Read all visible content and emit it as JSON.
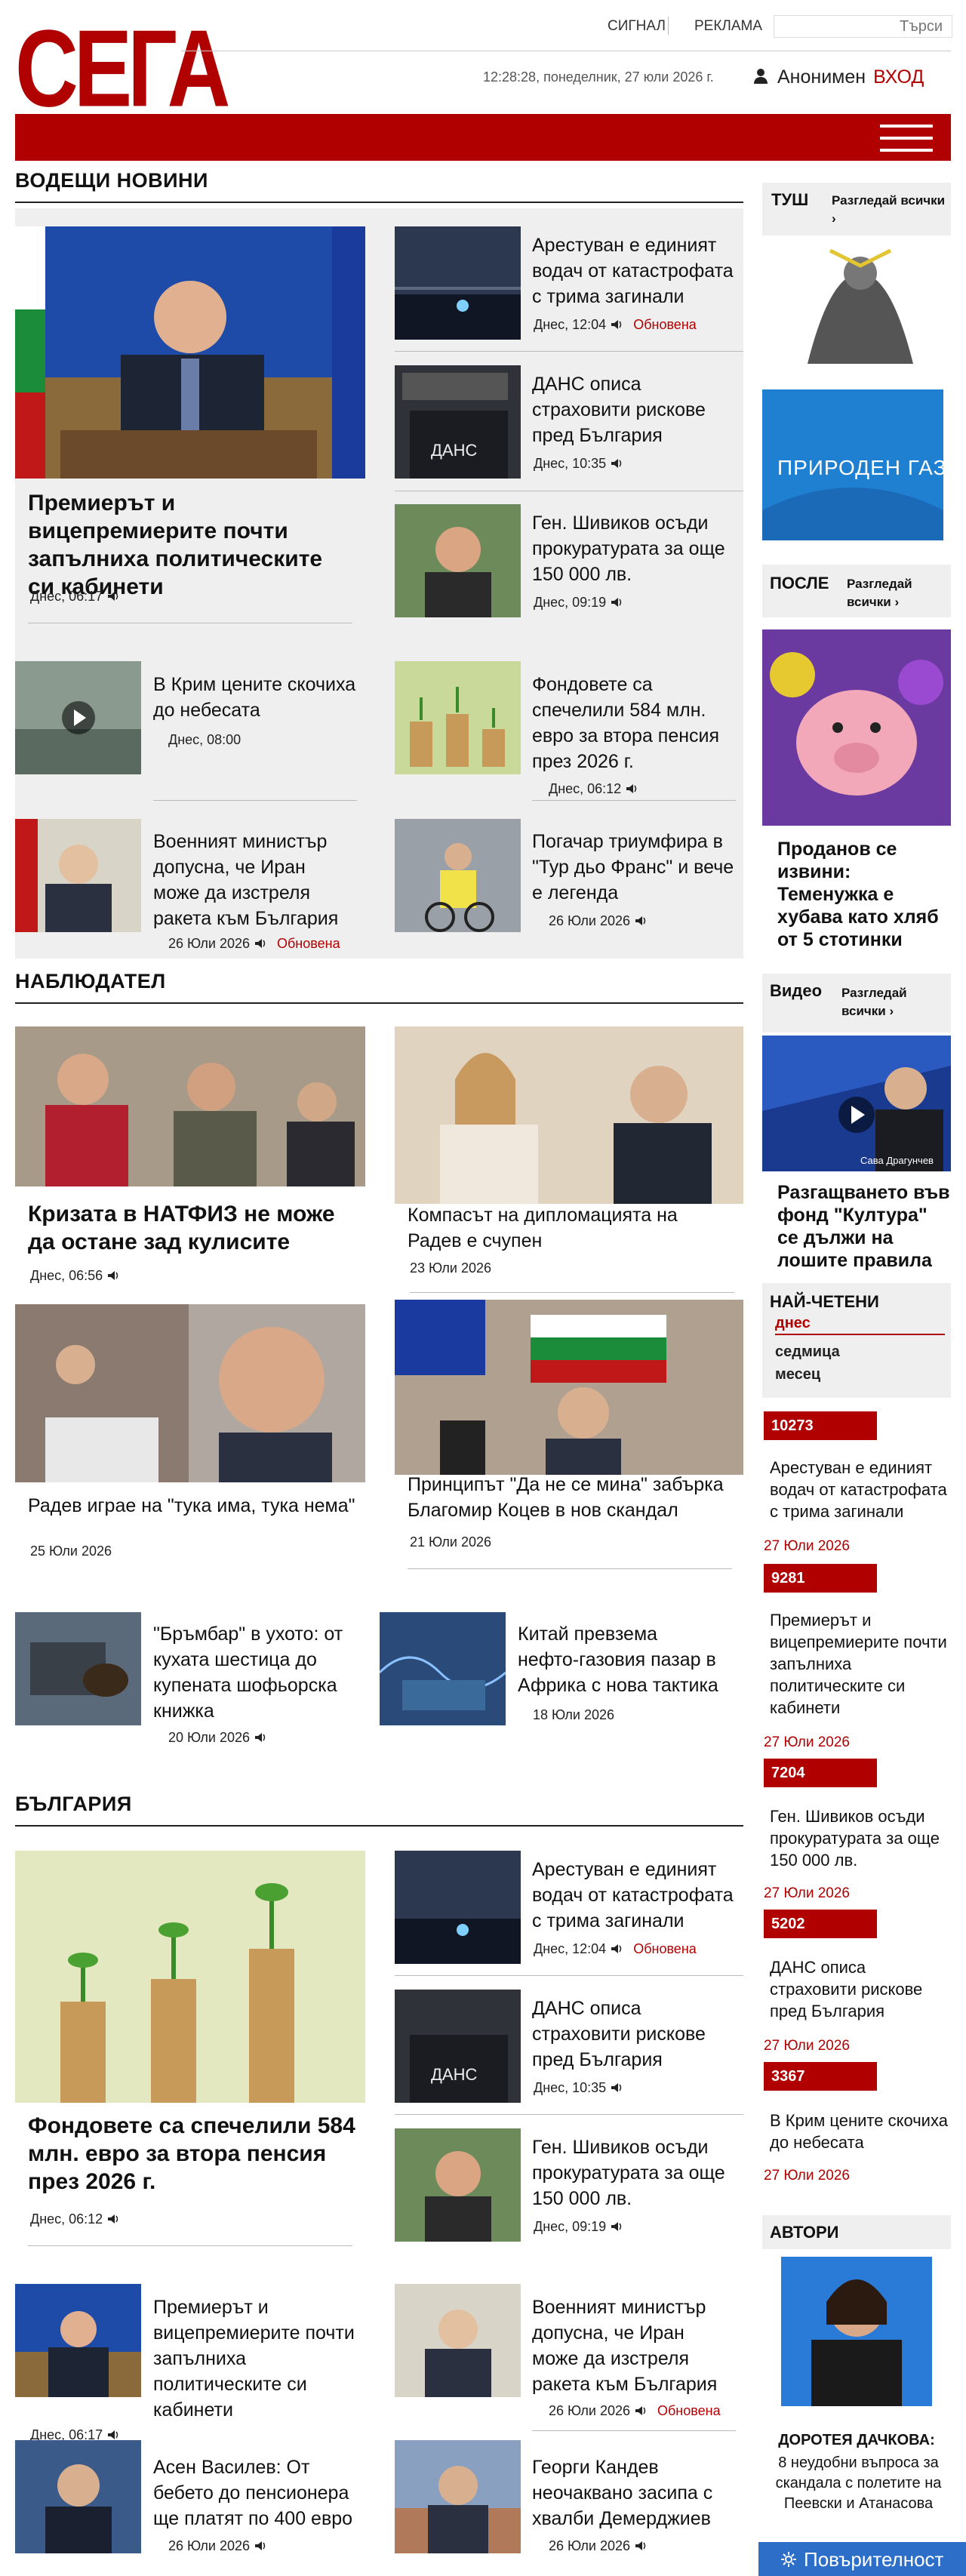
{
  "header": {
    "logo": "СЕГА",
    "links": [
      "СИГНАЛ",
      "РЕКЛАМА"
    ],
    "search_placeholder": "Търси",
    "datetime": "12:28:28, понеделник, 27 юли 2026 г.",
    "user": "Анонимен",
    "login": "ВХОД"
  },
  "sections": {
    "lead": "ВОДЕЩИ НОВИНИ",
    "observer": "НАБЛЮДАТЕЛ",
    "bulgaria": "БЪЛГАРИЯ"
  },
  "lead": {
    "main": {
      "title": "Премиерът и вицепремиерите почти запълниха политическите си кабинети",
      "meta": "Днес, 06:17"
    },
    "side": [
      {
        "title": "Арестуван е единият водач от катастрофата с трима загинали",
        "meta": "Днес, 12:04",
        "badge": "Обновена"
      },
      {
        "title": "ДАНС описа страховити рискове пред България",
        "meta": "Днес, 10:35"
      },
      {
        "title": "Ген. Шивиков осъди прокуратурата за още 150 000 лв.",
        "meta": "Днес, 09:19"
      }
    ],
    "small": [
      {
        "title": "В Крим цените скочиха до небесата",
        "meta": "Днес, 08:00"
      },
      {
        "title": "Фондовете са спечелили 584 млн. евро за втора пенсия през 2026 г.",
        "meta": "Днес, 06:12"
      },
      {
        "title": "Военният министър допусна, че Иран може да изстреля ракета към България",
        "meta": "26 Юли 2026",
        "badge": "Обновена"
      },
      {
        "title": "Погачар триумфира в \"Тур дьо Франс\" и вече е легенда",
        "meta": "26 Юли 2026"
      }
    ]
  },
  "observer": {
    "cards": [
      {
        "title": "Кризата в НАТФИЗ не може да остане зад кулисите",
        "meta": "Днес, 06:56"
      },
      {
        "title": "Компасът на дипломацията на Радев е счупен",
        "meta": "23 Юли 2026"
      },
      {
        "title": "Радев играе на \"тука има, тука нема\"",
        "meta": "25 Юли 2026"
      },
      {
        "title": "Принципът \"Да не се мина\" забърка Благомир Коцев в нов скандал",
        "meta": "21 Юли 2026"
      }
    ],
    "small": [
      {
        "title": "\"Бръмбар\" в ухото: от кухата шестица до купената шофьорска книжка",
        "meta": "20 Юли 2026"
      },
      {
        "title": "Китай превзема нефто-газовия пазар в Африка с нова тактика",
        "meta": "18 Юли 2026"
      }
    ]
  },
  "bulgaria": {
    "main": {
      "title": "Фондовете са спечелили 584 млн. евро за втора пенсия през 2026 г.",
      "meta": "Днес, 06:12"
    },
    "side": [
      {
        "title": "Арестуван е единият водач от катастрофата с трима загинали",
        "meta": "Днес, 12:04",
        "badge": "Обновена"
      },
      {
        "title": "ДАНС описа страховити рискове пред България",
        "meta": "Днес, 10:35"
      },
      {
        "title": "Ген. Шивиков осъди прокуратурата за още 150 000 лв.",
        "meta": "Днес, 09:19"
      }
    ],
    "small": [
      {
        "title": "Премиерът и вицепремиерите почти запълниха политическите си кабинети",
        "meta": "Днес, 06:17"
      },
      {
        "title": "Военният министър допусна, че Иран може да изстреля ракета към България",
        "meta": "26 Юли 2026",
        "badge": "Обновена"
      },
      {
        "title": "Асен Василев: От бебето до пенсионера ще платят по 400 евро",
        "meta": "26 Юли 2026"
      },
      {
        "title": "Георги Кандев неочаквано засипа с хвалби Демерджиев",
        "meta": "26 Юли 2026"
      }
    ]
  },
  "sidebar": {
    "tush": {
      "label": "ТУШ",
      "more": "Разгледай всички"
    },
    "ad": "ПРИРОДЕН ГАЗ",
    "posle": {
      "label": "ПОСЛЕ",
      "more": "Разгледай всички",
      "title": "Проданов се извини: Теменужка е хубава като хляб от 5 стотинки"
    },
    "video": {
      "label": "Видео",
      "more": "Разгледай всички",
      "caption": "Сава Драгунчев",
      "title": "Разгащването във фонд \"Култура\" се дължи на лошите правила"
    },
    "most_read": {
      "label": "НАЙ-ЧЕТЕНИ",
      "tabs": [
        "днес",
        "седмица",
        "месец"
      ],
      "items": [
        {
          "count": "10273",
          "title": "Арестуван е единият водач от катастрофата с трима загинали",
          "date": "27 Юли 2026"
        },
        {
          "count": "9281",
          "title": "Премиерът и вицепремиерите почти запълниха политическите си кабинети",
          "date": "27 Юли 2026"
        },
        {
          "count": "7204",
          "title": "Ген. Шивиков осъди прокуратурата за още 150 000 лв.",
          "date": "27 Юли 2026"
        },
        {
          "count": "5202",
          "title": "ДАНС описа страховити рискове пред България",
          "date": "27 Юли 2026"
        },
        {
          "count": "3367",
          "title": "В Крим цените скочиха до небесата",
          "date": "27 Юли 2026"
        }
      ]
    },
    "authors": {
      "label": "АВТОРИ",
      "name": "ДОРОТЕЯ ДАЧКОВА:",
      "title": "8 неудобни въпроса за скандала с полетите на Пеевски и Атанасова"
    }
  },
  "accessibility": "Повърителност"
}
